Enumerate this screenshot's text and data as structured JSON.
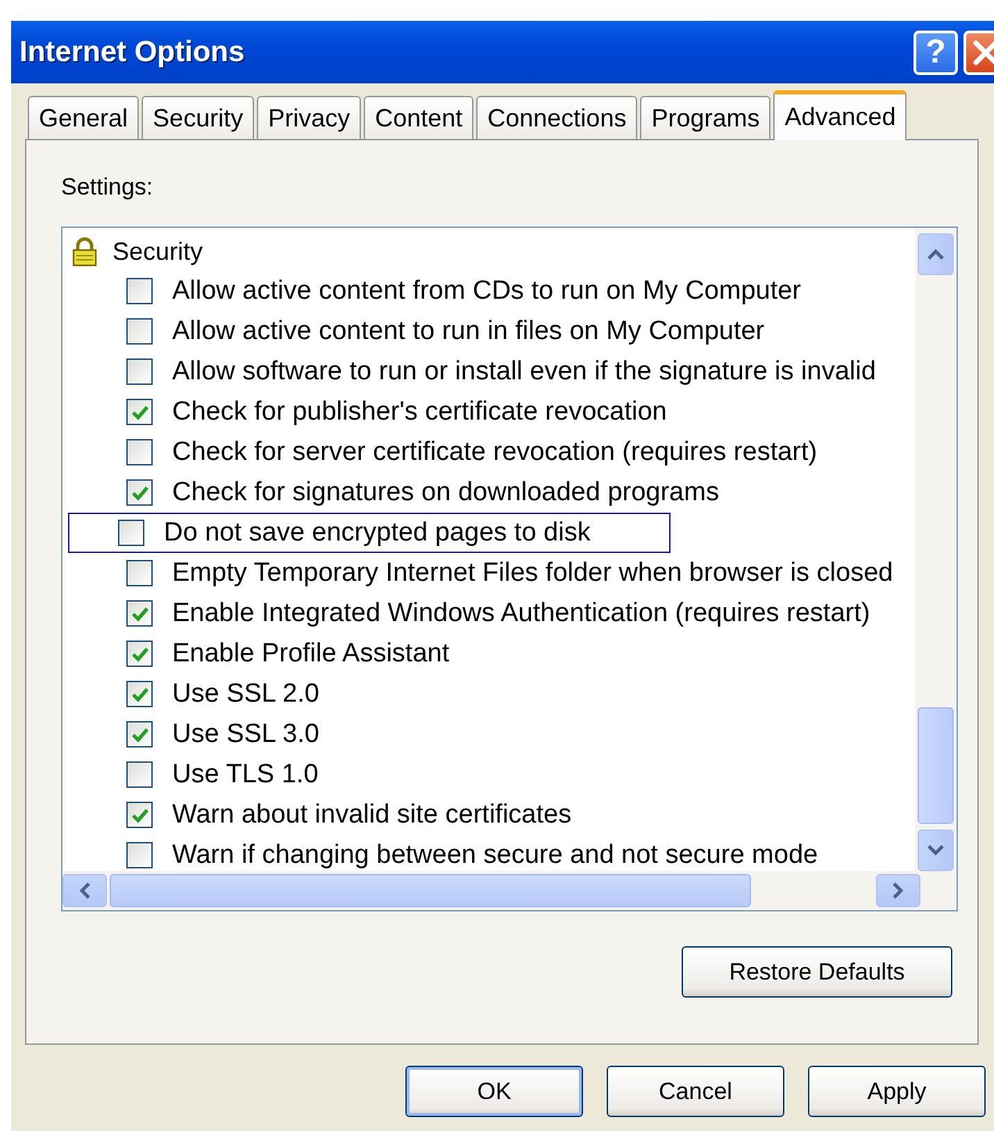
{
  "window": {
    "title": "Internet Options",
    "help_button": "?"
  },
  "tabs": [
    {
      "label": "General",
      "selected": false
    },
    {
      "label": "Security",
      "selected": false
    },
    {
      "label": "Privacy",
      "selected": false
    },
    {
      "label": "Content",
      "selected": false
    },
    {
      "label": "Connections",
      "selected": false
    },
    {
      "label": "Programs",
      "selected": false
    },
    {
      "label": "Advanced",
      "selected": true
    }
  ],
  "settings_label": "Settings:",
  "settings": {
    "group": "Security",
    "items": [
      {
        "label": "Allow active content from CDs to run on My Computer",
        "checked": false,
        "selected": false
      },
      {
        "label": "Allow active content to run in files on My Computer",
        "checked": false,
        "selected": false
      },
      {
        "label": "Allow software to run or install even if the signature is invalid",
        "checked": false,
        "selected": false
      },
      {
        "label": "Check for publisher's certificate revocation",
        "checked": true,
        "selected": false
      },
      {
        "label": "Check for server certificate revocation (requires restart)",
        "checked": false,
        "selected": false
      },
      {
        "label": "Check for signatures on downloaded programs",
        "checked": true,
        "selected": false
      },
      {
        "label": "Do not save encrypted pages to disk",
        "checked": false,
        "selected": true
      },
      {
        "label": "Empty Temporary Internet Files folder when browser is closed",
        "checked": false,
        "selected": false
      },
      {
        "label": "Enable Integrated Windows Authentication (requires restart)",
        "checked": true,
        "selected": false
      },
      {
        "label": "Enable Profile Assistant",
        "checked": true,
        "selected": false
      },
      {
        "label": "Use SSL 2.0",
        "checked": true,
        "selected": false
      },
      {
        "label": "Use SSL 3.0",
        "checked": true,
        "selected": false
      },
      {
        "label": "Use TLS 1.0",
        "checked": false,
        "selected": false
      },
      {
        "label": "Warn about invalid site certificates",
        "checked": true,
        "selected": false
      },
      {
        "label": "Warn if changing between secure and not secure mode",
        "checked": false,
        "selected": false
      }
    ]
  },
  "restore_button": "Restore Defaults",
  "buttons": [
    "OK",
    "Cancel",
    "Apply"
  ]
}
